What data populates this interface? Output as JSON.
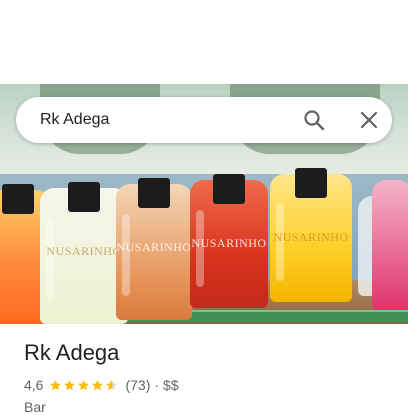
{
  "search": {
    "query": "Rk Adega"
  },
  "hero": {
    "pouch_brand": "NUSARINHO"
  },
  "place": {
    "name": "Rk Adega",
    "rating": "4,6",
    "stars": 4.6,
    "reviews": "(73)",
    "separator": "·",
    "price": "$$",
    "category": "Bar"
  },
  "icons": {
    "search": "search-icon",
    "close": "close-icon",
    "star": "star-icon"
  },
  "colors": {
    "star": "#fbbc04",
    "text_primary": "#202124",
    "text_secondary": "#5f6368"
  }
}
